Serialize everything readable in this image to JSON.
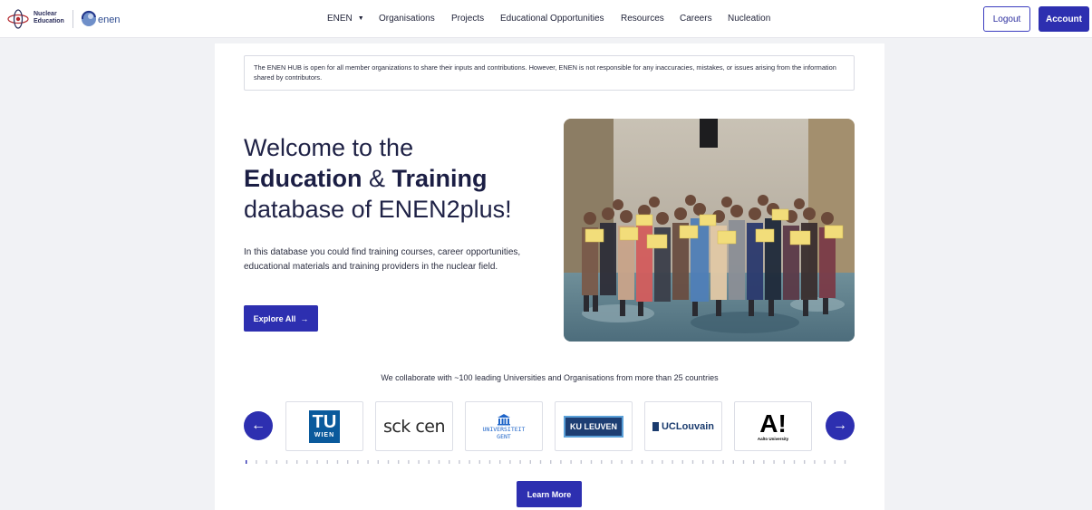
{
  "nav": {
    "logo_nuclear_line1": "Nuclear",
    "logo_nuclear_line2": "Education",
    "logo_enen": "enen",
    "links": [
      {
        "label": "ENEN"
      },
      {
        "label": "Organisations"
      },
      {
        "label": "Projects"
      },
      {
        "label": "Educational Opportunities"
      },
      {
        "label": "Resources"
      },
      {
        "label": "Careers"
      },
      {
        "label": "Nucleation"
      }
    ],
    "logout_label": "Logout",
    "account_label": "Account"
  },
  "disclaimer": "The ENEN HUB is open for all member organizations to share their inputs and contributions. However, ENEN is not responsible for any inaccuracies, mistakes, or issues arising from the information shared by contributors.",
  "hero": {
    "title_line1": "Welcome to the",
    "title_bold1": "Education",
    "title_amp": " & ",
    "title_bold2": "Training",
    "title_line3": "database of ENEN2plus!",
    "description": "In this database you could find training courses, career opportunities, educational materials and training providers in the nuclear field.",
    "explore_label": "Explore All",
    "explore_arrow": "→"
  },
  "collab": {
    "text": "We collaborate with ~100 leading Universities and Organisations from more than 25 countries",
    "prev_arrow": "←",
    "next_arrow": "→",
    "partners": [
      {
        "name": "TU WIEN",
        "line1": "TU",
        "line2": "WIEN"
      },
      {
        "name": "sck cen",
        "text": "sck cen"
      },
      {
        "name": "UNIVERSITEIT GENT",
        "line1": "UNIVERSITEIT",
        "line2": "GENT"
      },
      {
        "name": "KU LEUVEN",
        "text": "KU LEUVEN"
      },
      {
        "name": "UCLouvain",
        "text": "UCLouvain"
      },
      {
        "name": "Aalto University",
        "line1": "A!",
        "line2": "Aalto University"
      }
    ],
    "slide_count": 60,
    "active_slide": 1
  },
  "learn_more_label": "Learn More",
  "colors": {
    "primary": "#2d2fb0",
    "text_dark": "#1f2246",
    "page_bg": "#f1f2f5"
  }
}
